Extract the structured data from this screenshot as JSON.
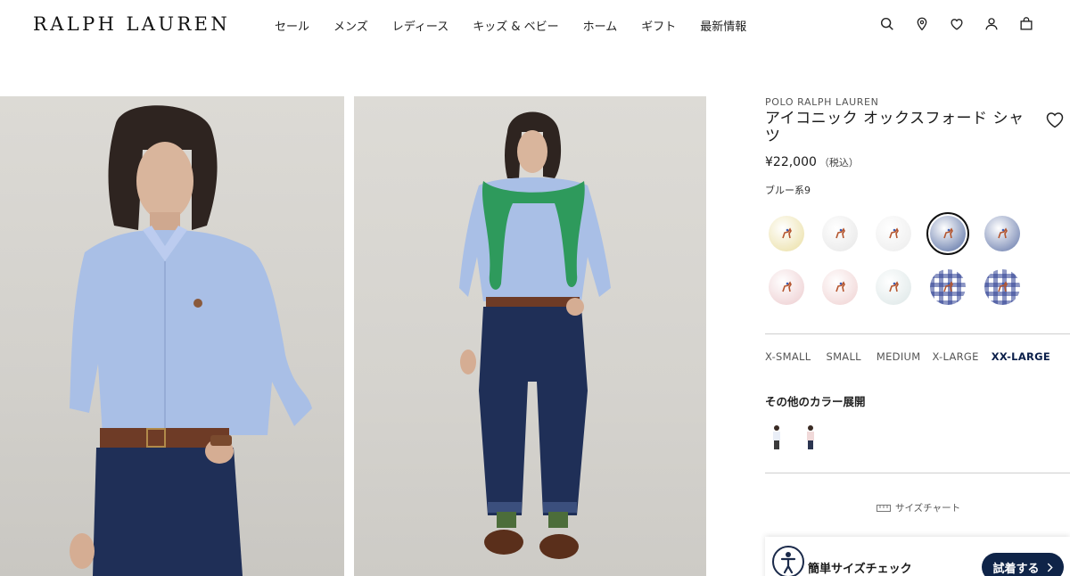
{
  "header": {
    "logo": "RALPH LAUREN",
    "nav": [
      "セール",
      "メンズ",
      "レディース",
      "キッズ & ベビー",
      "ホーム",
      "ギフト",
      "最新情報"
    ],
    "icons": [
      "search-icon",
      "location-icon",
      "heart-icon",
      "account-icon",
      "bag-icon"
    ]
  },
  "product": {
    "brand": "POLO RALPH LAUREN",
    "title": "アイコニック オックスフォード シャツ",
    "price": "¥22,000",
    "tax_note": "（税込）",
    "color_name": "ブルー系9",
    "swatches": [
      {
        "color": "#efe6b8",
        "pattern": "solid"
      },
      {
        "color": "#ececec",
        "pattern": "solid"
      },
      {
        "color": "#f0f0f0",
        "pattern": "solid"
      },
      {
        "color": "#7d8fb8",
        "pattern": "solid",
        "selected": true
      },
      {
        "color": "#8796bd",
        "pattern": "solid"
      },
      {
        "color": "#f1d8da",
        "pattern": "solid"
      },
      {
        "color": "#f3dcdc",
        "pattern": "solid"
      },
      {
        "color": "#e4ecec",
        "pattern": "solid"
      },
      {
        "color": "#2d3f93",
        "pattern": "gingham"
      },
      {
        "color": "#2d3f93",
        "pattern": "gingham"
      }
    ],
    "sizes": [
      "X-SMALL",
      "SMALL",
      "MEDIUM",
      "X-LARGE",
      "XX-LARGE"
    ],
    "selected_size": "XX-LARGE",
    "other_colors_heading": "その他のカラー展開",
    "size_chart": "サイズチャート",
    "fit_check_label": "簡単サイズチェック",
    "fit_check_button": "試着する"
  }
}
